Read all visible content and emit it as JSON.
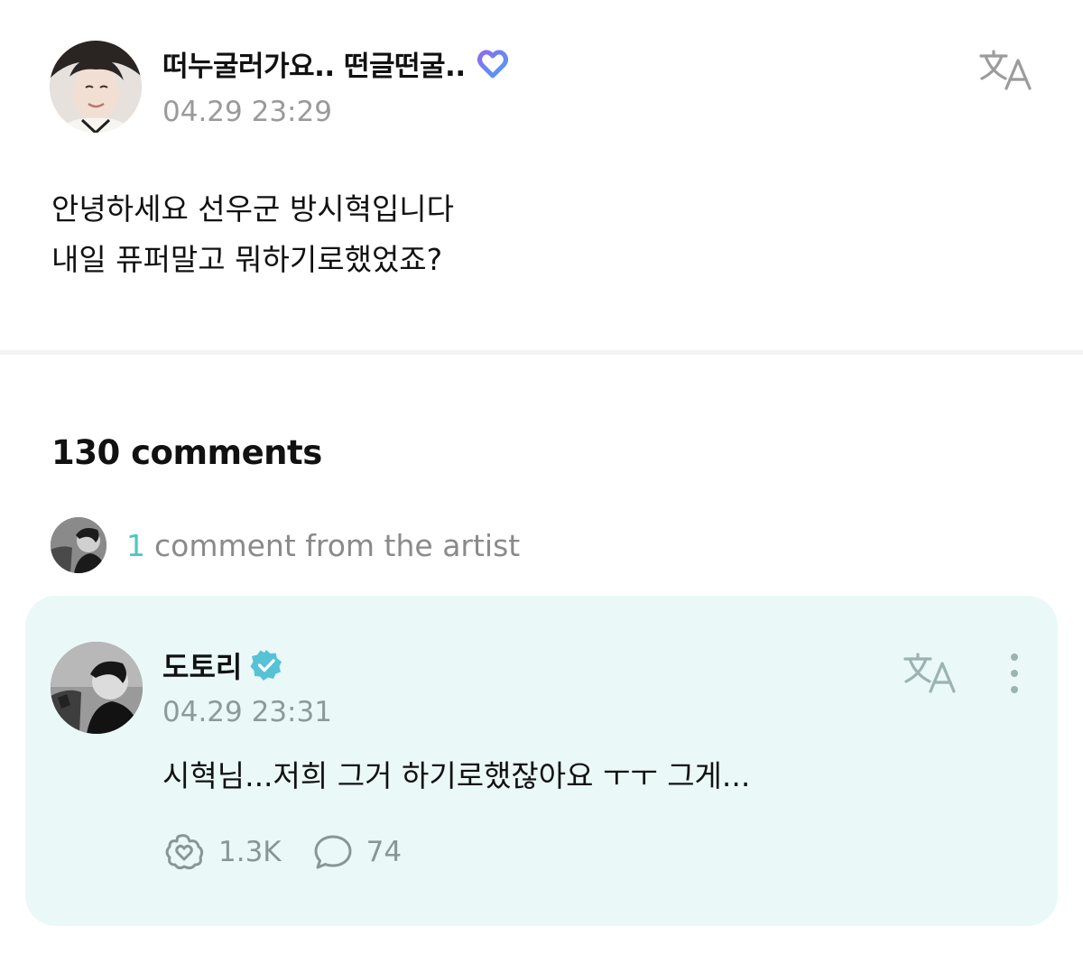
{
  "post": {
    "author_name": "떠누굴러가요.. 떤글떤굴..",
    "timestamp": "04.29 23:29",
    "body_lines": [
      "안녕하세요 선우군 방시혁입니다",
      "내일 퓨퍼말고 뭐하기로했었죠?"
    ],
    "badge_icon": "heart-membership-badge-icon",
    "translate_icon": "translate-icon"
  },
  "comments_section": {
    "count_label": "130 comments",
    "artist_summary": {
      "count": "1",
      "text": "comment from the artist",
      "count_color": "#4fc6c4"
    }
  },
  "artist_comment": {
    "author_name": "도토리",
    "verified_icon": "verified-badge-icon",
    "timestamp": "04.29 23:31",
    "text": "시혁님...저희 그거 하기로했잖아요 ㅜㅜ 그게...",
    "likes": "1.3K",
    "replies": "74",
    "card_color": "#eaf9f7"
  }
}
